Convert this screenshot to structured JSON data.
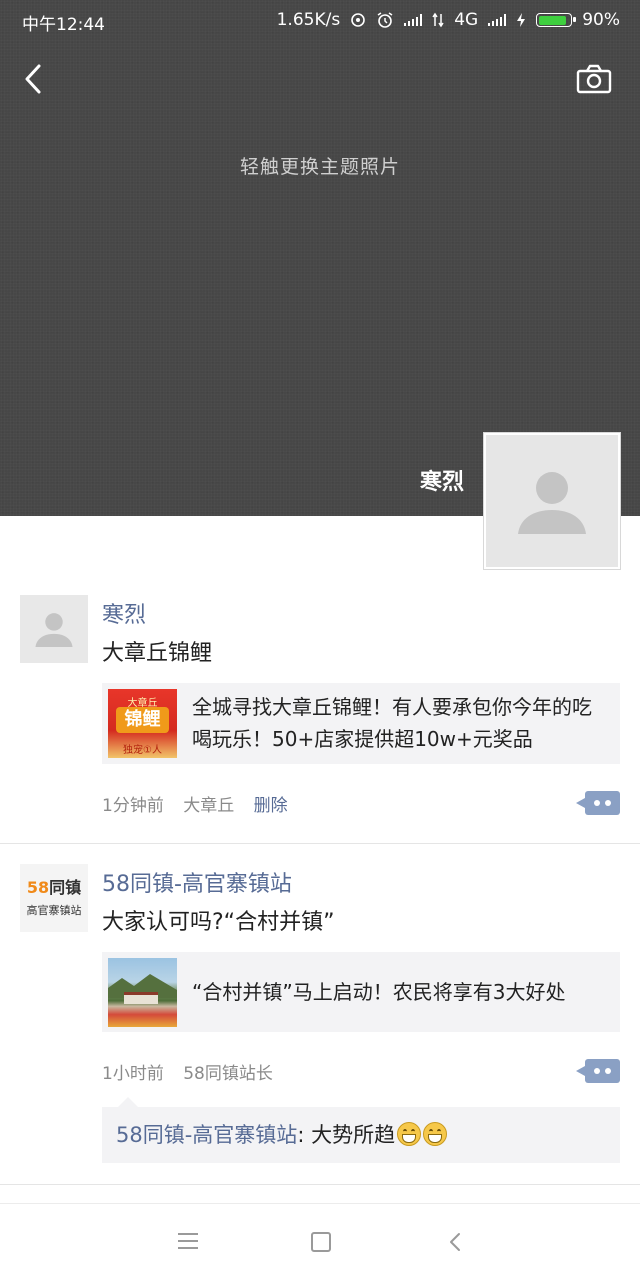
{
  "status_bar": {
    "time": "中午12:44",
    "net_speed": "1.65K/s",
    "network": "4G",
    "battery": "90%",
    "battery_level": 0.9
  },
  "header": {
    "back_icon": "back-arrow-icon",
    "camera_icon": "camera-icon",
    "cover_hint": "轻触更换主题照片",
    "owner_name": "寒烈",
    "owner_avatar_icon": "default-avatar-icon"
  },
  "posts": [
    {
      "author": "寒烈",
      "text": "大章丘锦鲤",
      "link_text": "全城寻找大章丘锦鲤！有人要承包你今年的吃喝玩乐！50+店家提供超10w+元奖品",
      "thumb": {
        "top_label": "大章丘",
        "main_label": "锦鲤",
        "bottom_label": "独宠①人"
      },
      "time": "1分钟前",
      "location": "大章丘",
      "delete_label": "删除"
    },
    {
      "author": "58同镇-高官寨镇站",
      "avatar": {
        "line1_num": "58",
        "line1_text": "同镇",
        "line2": "高官寨镇站"
      },
      "text": "大家认可吗?“合村并镇”",
      "link_text": "“合村并镇”马上启动！农民将享有3大好处",
      "time": "1小时前",
      "source": "58同镇站长",
      "comments": [
        {
          "author": "58同镇-高官寨镇站",
          "sep": ": ",
          "text": "大势所趋"
        }
      ]
    }
  ],
  "nav_bar": {
    "menu_icon": "menu-icon",
    "home_icon": "home-square-icon",
    "back_icon": "back-triangle-icon"
  }
}
